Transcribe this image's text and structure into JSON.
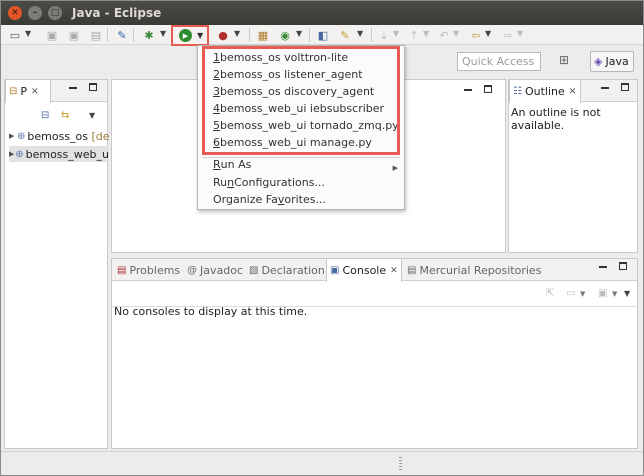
{
  "window": {
    "title": "Java - Eclipse"
  },
  "toolbar": {
    "quick_access_placeholder": "Quick Access",
    "perspective_label": "Java"
  },
  "package_explorer": {
    "tab_label": "P",
    "items": [
      {
        "name": "bemoss_os",
        "decoration": "[de"
      },
      {
        "name": "bemoss_web_u",
        "decoration": ""
      }
    ]
  },
  "outline": {
    "tab_label": "Outline",
    "message_line1": "An outline is not",
    "message_line2": "available."
  },
  "bottom_panel": {
    "tabs": [
      {
        "label": "Problems"
      },
      {
        "label": "Javadoc"
      },
      {
        "label": "Declaration"
      },
      {
        "label": "Console"
      },
      {
        "label": "Mercurial Repositories"
      }
    ],
    "console_message": "No consoles to display at this time."
  },
  "run_menu": {
    "recent": [
      {
        "num": "1",
        "label": " bemoss_os volttron-lite"
      },
      {
        "num": "2",
        "label": " bemoss_os listener_agent"
      },
      {
        "num": "3",
        "label": " bemoss_os discovery_agent"
      },
      {
        "num": "4",
        "label": " bemoss_web_ui iebsubscriber"
      },
      {
        "num": "5",
        "label": " bemoss_web_ui tornado_zmq.py"
      },
      {
        "num": "6",
        "label": " bemoss_web_ui manage.py"
      }
    ],
    "run_as": {
      "pre": "",
      "acc": "R",
      "post": "un As"
    },
    "run_configurations": {
      "pre": "Ru",
      "acc": "n",
      "post": " Configurations..."
    },
    "organize_favorites": {
      "pre": "Organize Fa",
      "acc": "v",
      "post": "orites..."
    }
  },
  "colors": {
    "highlight": "#e85b52",
    "run_green": "#2e8b2e"
  }
}
